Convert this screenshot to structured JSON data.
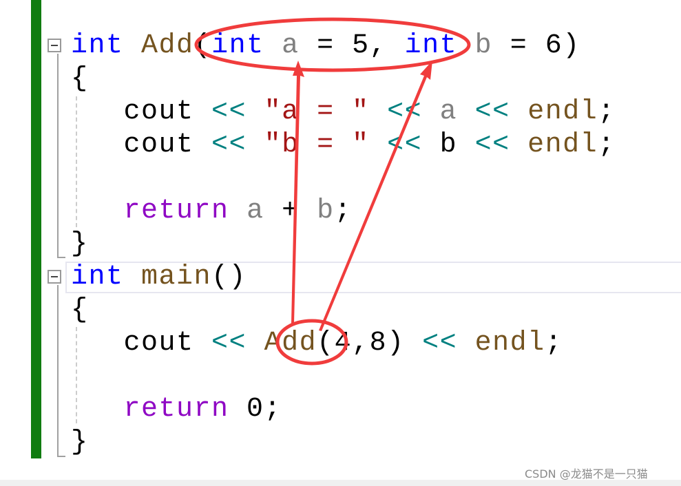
{
  "colors": {
    "keyword": "#0000ff",
    "function": "#74531f",
    "param": "#808080",
    "string": "#a31515",
    "operator": "#008080",
    "control": "#8f08c4",
    "plain": "#000000",
    "annotation": "#f03c3c"
  },
  "code_lines": [
    [
      [
        "keyword",
        "int"
      ],
      [
        "plain",
        " "
      ],
      [
        "function",
        "Add"
      ],
      [
        "plain",
        "("
      ],
      [
        "keyword",
        "int"
      ],
      [
        "plain",
        " "
      ],
      [
        "param",
        "a"
      ],
      [
        "plain",
        " = 5, "
      ],
      [
        "keyword",
        "int"
      ],
      [
        "plain",
        " "
      ],
      [
        "param",
        "b"
      ],
      [
        "plain",
        " = 6)"
      ]
    ],
    [
      [
        "plain",
        "{"
      ]
    ],
    [
      [
        "plain",
        "   cout "
      ],
      [
        "operator",
        "<<"
      ],
      [
        "plain",
        " "
      ],
      [
        "string",
        "\"a = \""
      ],
      [
        "plain",
        " "
      ],
      [
        "operator",
        "<<"
      ],
      [
        "plain",
        " "
      ],
      [
        "param",
        "a"
      ],
      [
        "plain",
        " "
      ],
      [
        "operator",
        "<<"
      ],
      [
        "plain",
        " "
      ],
      [
        "function",
        "endl"
      ],
      [
        "plain",
        ";"
      ]
    ],
    [
      [
        "plain",
        "   cout "
      ],
      [
        "operator",
        "<<"
      ],
      [
        "plain",
        " "
      ],
      [
        "string",
        "\"b = \""
      ],
      [
        "plain",
        " "
      ],
      [
        "operator",
        "<<"
      ],
      [
        "plain",
        " b "
      ],
      [
        "operator",
        "<<"
      ],
      [
        "plain",
        " "
      ],
      [
        "function",
        "endl"
      ],
      [
        "plain",
        ";"
      ]
    ],
    [],
    [
      [
        "plain",
        "   "
      ],
      [
        "control",
        "return"
      ],
      [
        "plain",
        " "
      ],
      [
        "param",
        "a"
      ],
      [
        "plain",
        " + "
      ],
      [
        "param",
        "b"
      ],
      [
        "plain",
        ";"
      ]
    ],
    [
      [
        "plain",
        "}"
      ]
    ],
    [
      [
        "keyword",
        "int"
      ],
      [
        "plain",
        " "
      ],
      [
        "function",
        "main"
      ],
      [
        "plain",
        "()"
      ]
    ],
    [
      [
        "plain",
        "{"
      ]
    ],
    [
      [
        "plain",
        "   cout "
      ],
      [
        "operator",
        "<<"
      ],
      [
        "plain",
        " "
      ],
      [
        "function",
        "Add"
      ],
      [
        "plain",
        "(4,8) "
      ],
      [
        "operator",
        "<<"
      ],
      [
        "plain",
        " "
      ],
      [
        "function",
        "endl"
      ],
      [
        "plain",
        ";"
      ]
    ],
    [],
    [
      [
        "plain",
        "   "
      ],
      [
        "control",
        "return"
      ],
      [
        "plain",
        " 0;"
      ]
    ],
    [
      [
        "plain",
        "}"
      ]
    ]
  ],
  "watermark": "CSDN @龙猫不是一只猫"
}
